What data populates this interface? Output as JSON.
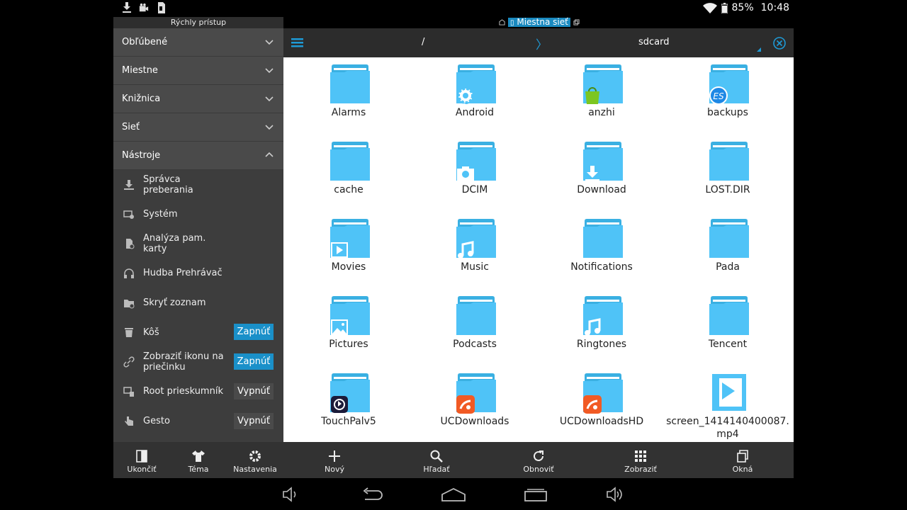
{
  "status_bar": {
    "battery": "85%",
    "time": "10:48"
  },
  "top_tabs": {
    "active_tab": "Miestna sieť"
  },
  "sidebar": {
    "title": "Rýchly prístup",
    "sections": [
      {
        "label": "Obľúbené"
      },
      {
        "label": "Miestne"
      },
      {
        "label": "Knižnica"
      },
      {
        "label": "Sieť"
      },
      {
        "label": "Nástroje"
      }
    ],
    "tools": [
      {
        "label": "Správca preberania",
        "icon": "download-icon"
      },
      {
        "label": "Systém",
        "icon": "system-icon"
      },
      {
        "label": "Analýza pam. karty",
        "icon": "sdcard-icon"
      },
      {
        "label": "Hudba Prehrávač",
        "icon": "headphones-icon"
      },
      {
        "label": "Skryť zoznam",
        "icon": "hidden-folder-icon"
      },
      {
        "label": "Kôš",
        "icon": "trash-icon",
        "toggle": "Zapnúť"
      },
      {
        "label": "Zobraziť ikonu na priečinku",
        "icon": "link-icon",
        "toggle": "Zapnúť"
      },
      {
        "label": "Root prieskumník",
        "icon": "root-icon",
        "toggle": "Vypnúť"
      },
      {
        "label": "Gesto",
        "icon": "gesture-icon",
        "toggle": "Vypnúť"
      }
    ]
  },
  "path_bar": {
    "root": "/",
    "separator": "〉",
    "current": "sdcard"
  },
  "files": [
    {
      "name": "Alarms"
    },
    {
      "name": "Android",
      "badge": "gear-icon"
    },
    {
      "name": "anzhi",
      "badge": "shopping-bag-icon"
    },
    {
      "name": "backups",
      "badge": "es-icon"
    },
    {
      "name": "cache"
    },
    {
      "name": "DCIM",
      "badge": "camera-icon"
    },
    {
      "name": "Download",
      "badge": "download-icon"
    },
    {
      "name": "LOST.DIR"
    },
    {
      "name": "Movies",
      "badge": "play-icon"
    },
    {
      "name": "Music",
      "badge": "music-note-icon"
    },
    {
      "name": "Notifications"
    },
    {
      "name": "Pada"
    },
    {
      "name": "Pictures",
      "badge": "picture-icon"
    },
    {
      "name": "Podcasts"
    },
    {
      "name": "Ringtones",
      "badge": "music-note-icon"
    },
    {
      "name": "Tencent"
    },
    {
      "name": "TouchPalv5",
      "badge": "touchpal-icon"
    },
    {
      "name": "UCDownloads",
      "badge": "uc-browser-icon"
    },
    {
      "name": "UCDownloadsHD",
      "badge": "uc-browser-icon"
    },
    {
      "name": "screen_1414140400087.mp4",
      "type": "video-file"
    }
  ],
  "bottom_left": [
    {
      "label": "Ukončiť",
      "icon": "exit-icon"
    },
    {
      "label": "Téma",
      "icon": "shirt-icon"
    },
    {
      "label": "Nastavenia",
      "icon": "gear-icon"
    }
  ],
  "bottom_right": [
    {
      "label": "Nový",
      "icon": "plus-icon"
    },
    {
      "label": "Hľadať",
      "icon": "search-icon"
    },
    {
      "label": "Obnoviť",
      "icon": "refresh-icon"
    },
    {
      "label": "Zobraziť",
      "icon": "grid-icon"
    },
    {
      "label": "Okná",
      "icon": "windows-icon"
    }
  ],
  "colors": {
    "accent": "#1a90c9",
    "folder": "#4fc3f7",
    "sidebar_bg": "#3d3d3d",
    "toolbar_bg": "#323232"
  }
}
